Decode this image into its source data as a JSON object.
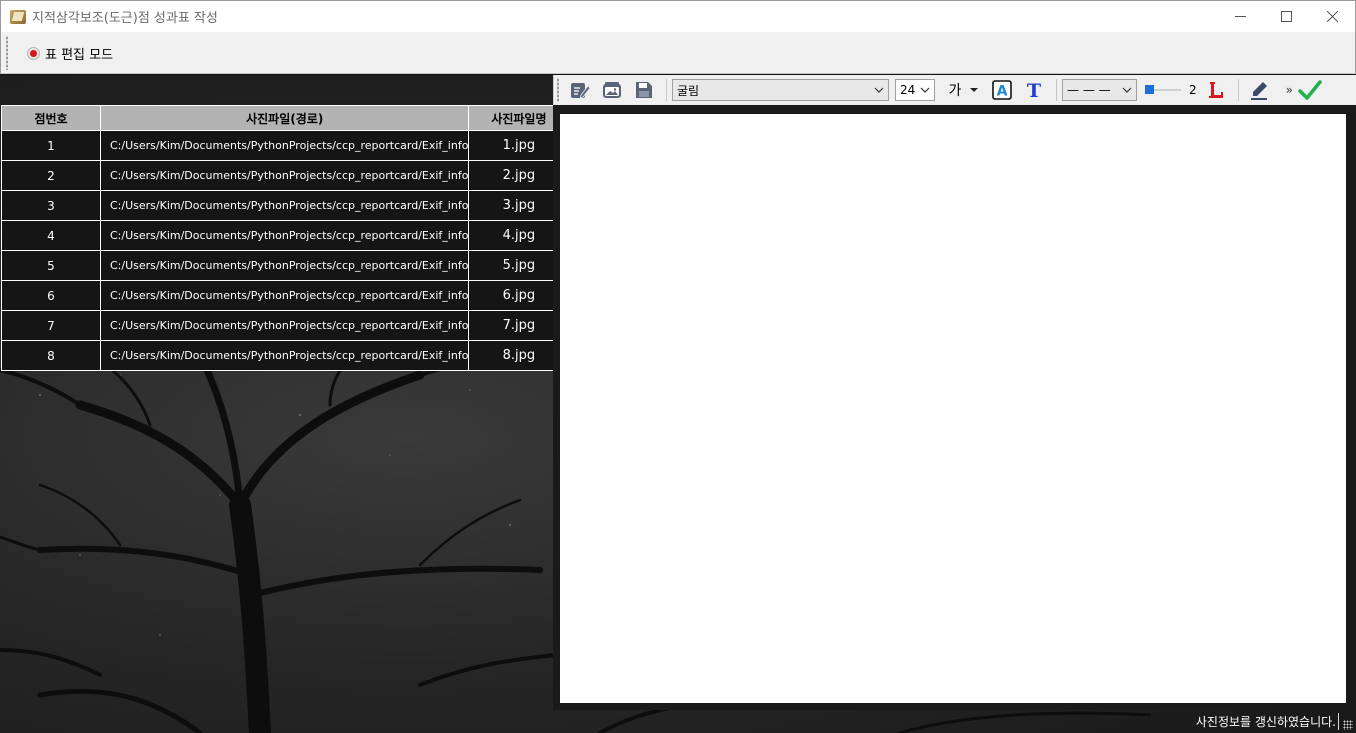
{
  "window": {
    "title": "지적삼각보조(도근)점 성과표 작성",
    "controls": {
      "minimize": "—",
      "maximize": "☐",
      "close": "✕"
    }
  },
  "modebar": {
    "toggle_label": "표 편집 모드"
  },
  "toolstrip": {
    "font_name": "굴림",
    "font_size": "24",
    "text_glyph": "가",
    "line_style": "— — —",
    "line_width": "2",
    "overflow": "»",
    "icons": [
      "edit-icon",
      "image-icon",
      "save-icon",
      "text-color-icon",
      "text-tool-icon",
      "line-tool-icon",
      "pen-icon",
      "check-icon"
    ],
    "colors": {
      "accent_blue": "#1e6fd9",
      "red": "#e0141c",
      "green": "#22b14c"
    }
  },
  "table": {
    "headers": [
      "점번호",
      "사진파일(경로)",
      "사진파일명"
    ],
    "rows": [
      [
        "1",
        "C:/Users/Kim/Documents/PythonProjects/ccp_reportcard/Exif_info",
        "1.jpg"
      ],
      [
        "2",
        "C:/Users/Kim/Documents/PythonProjects/ccp_reportcard/Exif_info",
        "2.jpg"
      ],
      [
        "3",
        "C:/Users/Kim/Documents/PythonProjects/ccp_reportcard/Exif_info",
        "3.jpg"
      ],
      [
        "4",
        "C:/Users/Kim/Documents/PythonProjects/ccp_reportcard/Exif_info",
        "4.jpg"
      ],
      [
        "5",
        "C:/Users/Kim/Documents/PythonProjects/ccp_reportcard/Exif_info",
        "5.jpg"
      ],
      [
        "6",
        "C:/Users/Kim/Documents/PythonProjects/ccp_reportcard/Exif_info",
        "6.jpg"
      ],
      [
        "7",
        "C:/Users/Kim/Documents/PythonProjects/ccp_reportcard/Exif_info",
        "7.jpg"
      ],
      [
        "8",
        "C:/Users/Kim/Documents/PythonProjects/ccp_reportcard/Exif_info",
        "8.jpg"
      ]
    ]
  },
  "status": {
    "message": "사진정보를 갱신하였습니다."
  }
}
